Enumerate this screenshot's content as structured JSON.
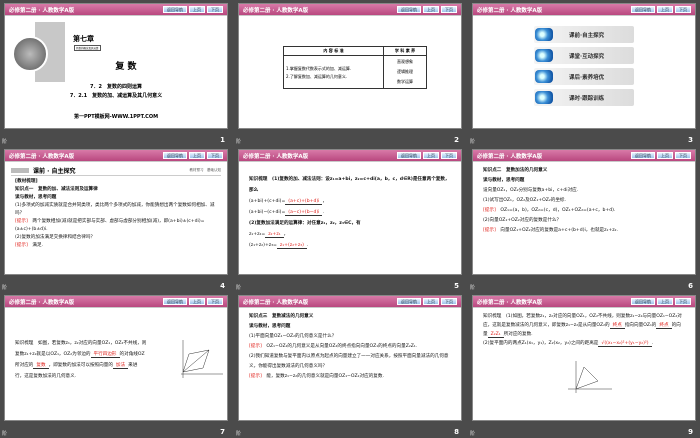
{
  "header": {
    "title": "必修第二册 · 人教数学A版",
    "nav_back": "返回导航",
    "prev": "上页",
    "next": "下页"
  },
  "corner_mark": "阶",
  "slides": [
    {
      "number": "1",
      "chapter": "第七章",
      "chapter_sub": "复数的概念及其运算",
      "title": "复 数",
      "section": "7．2　复数的四则运算",
      "subsection": "7．2.1　复数的加、减运算及其几何意义",
      "footer": "第一PPT模板网-WWW.1PPT.COM"
    },
    {
      "number": "2",
      "table": {
        "headers": [
          "内 容 标 准",
          "学 科 素 养"
        ],
        "left": [
          "1.掌握复数代数表示式的加、减运算.",
          "2.了解复数加、减运算的几何意义."
        ],
        "right": [
          "直观想象",
          "逻辑推理",
          "数学运算"
        ]
      }
    },
    {
      "number": "3",
      "nav": [
        "课前·自主探究",
        "课堂·互动探究",
        "课后·素养培优",
        "课时·跟踪训练"
      ]
    },
    {
      "number": "4",
      "section": "课前 · 自主探究",
      "section_sub": "教材预习　基础认知",
      "lines": [
        [
          {
            "t": "[教材梳理]",
            "b": true
          }
        ],
        [
          {
            "t": "知识点一　复数的加、减法法则及运算律",
            "b": true
          }
        ],
        [
          {
            "t": "读与教材，思考问题",
            "b": true
          }
        ],
        [
          {
            "t": "(1)多项式的加减实质就是合并同类项，类比两个多项式的加减，你能猜想出两个复数如何相加、减吗？"
          }
        ],
        [
          {
            "t": "[提示]",
            "r": true
          },
          {
            "t": "　两个复数相加(减)就是把实部与实部、虚部与虚部分别相加(减)，即(a+bi)±(c+di)=(a±c)+(b±d)i."
          }
        ],
        [
          {
            "t": "(2)复数的加法满足交换律和结合律吗？"
          }
        ],
        [
          {
            "t": "[提示]",
            "r": true
          },
          {
            "t": "　满足."
          }
        ]
      ]
    },
    {
      "number": "5",
      "lines": [
        [
          {
            "t": "知识梳理　(1)复数的加、减法法则：设z₁=a+bi，z₂=c+di(a，b，c，d∈R)是任意两个复数，那么",
            "b": true
          }
        ],
        [
          {
            "t": "(a+bi)+(c+di)="
          },
          {
            "t": "(a+c)+(b+d)i",
            "r": true,
            "u": true
          },
          {
            "t": "，"
          }
        ],
        [
          {
            "t": "(a+bi)−(c+di)="
          },
          {
            "t": "(a−c)+(b−d)i",
            "r": true,
            "u": true
          },
          {
            "t": "."
          }
        ],
        [
          {
            "t": "(2)复数加法满足的运算律：对任意z₁，z₂，z₃∈C，有",
            "b": true
          }
        ],
        [
          {
            "t": "z₁+z₂="
          },
          {
            "t": "z₂+z₁",
            "r": true,
            "u": true
          },
          {
            "t": "，"
          }
        ],
        [
          {
            "t": "(z₁+z₂)+z₃="
          },
          {
            "t": "z₁+(z₂+z₃)",
            "r": true,
            "u": true
          },
          {
            "t": "."
          }
        ]
      ]
    },
    {
      "number": "6",
      "lines": [
        [
          {
            "t": "知识点二　复数加法的几何意义",
            "b": true
          }
        ],
        [
          {
            "t": "读与教材，思考问题",
            "b": true
          }
        ],
        [
          {
            "t": "设向量OZ₁，OZ₂分别与复数a+bi，c+di对应."
          }
        ],
        [
          {
            "t": "(1)试写出OZ₁，OZ₂及OZ₁+OZ₂的坐标."
          }
        ],
        [
          {
            "t": "[提示]",
            "r": true
          },
          {
            "t": "　OZ₁=(a，b)，OZ₂=(c，d)，OZ₁+OZ₂=(a+c，b+d)."
          }
        ],
        [
          {
            "t": "(2)向量OZ₁+OZ₂对应的复数是什么？"
          }
        ],
        [
          {
            "t": "[提示]",
            "r": true
          },
          {
            "t": "　向量OZ₁+OZ₂对应的复数是a+c+(b+d)i，也就是z₁+z₂."
          }
        ]
      ]
    },
    {
      "number": "7",
      "lines": [
        [
          {
            "t": "知识梳理　如图，若复数z₁，z₂对应的向量OZ₁，OZ₂不共线，则"
          }
        ],
        [
          {
            "t": "复数z₁+z₂就是以OZ₁，OZ₂为邻边的"
          },
          {
            "t": "平行四边形",
            "r": true,
            "u": true
          },
          {
            "t": "的对角线OZ"
          }
        ],
        [
          {
            "t": "所对应的"
          },
          {
            "t": "复数",
            "r": true,
            "u": true
          },
          {
            "t": "，即复数的加法可以按照向量的"
          },
          {
            "t": "加法",
            "r": true,
            "u": true
          },
          {
            "t": "来进"
          }
        ],
        [
          {
            "t": "行，这是复数加法的几何意义."
          }
        ]
      ]
    },
    {
      "number": "8",
      "lines": [
        [
          {
            "t": "知识点三　复数减法的几何意义",
            "b": true
          }
        ],
        [
          {
            "t": "读与教材，思考问题",
            "b": true
          }
        ],
        [
          {
            "t": "(1)平面向量OZ₁−OZ₂的几何意义是什么？"
          }
        ],
        [
          {
            "t": "[提示]",
            "r": true
          },
          {
            "t": "　OZ₁−OZ₂的几何意义是从向量OZ₂的终点指向向量OZ₁的终点的向量Z₂Z₁."
          }
        ],
        [
          {
            "t": "(2)我们知道复数与复平面内以原点为起点的向量建立了一一对应关系，按照平面向量减法的几何意义，你能得出复数减法的几何意义吗？"
          }
        ],
        [
          {
            "t": "[提示]",
            "r": true
          },
          {
            "t": "　能，复数z₁−z₂的几何意义就是向量OZ₁−OZ₂对应的复数."
          }
        ]
      ]
    },
    {
      "number": "9",
      "lines": [
        [
          {
            "t": "知识梳理　(1)如图，若复数z₁，z₂对应的向量OZ₁，OZ₂不共线，则复数z₁−z₂与向量OZ₁−OZ₂对应，这就是复数减法的几何意义，即复数z₁−z₂是从向量OZ₂的"
          },
          {
            "t": "终点",
            "r": true,
            "u": true
          },
          {
            "t": "指向向量OZ₁的"
          },
          {
            "t": "终点",
            "r": true,
            "u": true
          },
          {
            "t": "的向量"
          },
          {
            "t": "Z₂Z₁",
            "r": true,
            "u": true
          },
          {
            "t": "所对应的复数."
          }
        ],
        [
          {
            "t": "(2)复平面内的两点Z₁(x₁，y₁)，Z₂(x₂，y₂)之间的距离是"
          },
          {
            "t": "√((x₁−x₂)²+(y₁−y₂)²)",
            "r": true,
            "u": true
          },
          {
            "t": "."
          }
        ]
      ]
    }
  ],
  "colors": {
    "header_pink": "#c2578b",
    "answer_red": "#e0201a",
    "background": "#4b4b4b"
  }
}
